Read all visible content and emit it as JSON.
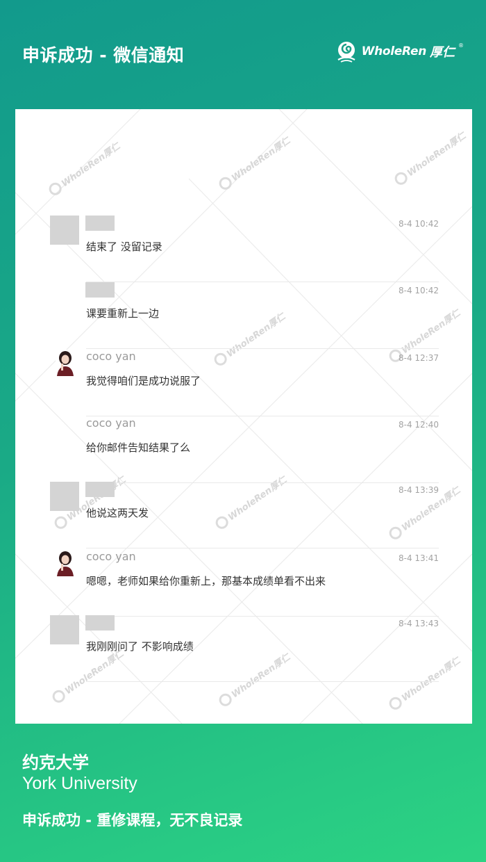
{
  "header": {
    "title": "申诉成功  - 微信通知"
  },
  "brand": {
    "logo_icon": "leaf-swirl-icon",
    "name": "WholeRen",
    "cn": "厚仁",
    "reg": "®"
  },
  "watermark": {
    "text": "WholeRen厚仁",
    "icon": "logo-icon"
  },
  "messages": [
    {
      "avatar": "gray-redacted",
      "name": "",
      "time": "8-4 10:42",
      "text": "结束了 没留记录"
    },
    {
      "avatar": "none",
      "name": "",
      "time": "8-4 10:42",
      "text": "课要重新上一边"
    },
    {
      "avatar": "photo",
      "name": "coco yan",
      "time": "8-4 12:37",
      "text": "我觉得咱们是成功说服了"
    },
    {
      "avatar": "none",
      "name": "coco yan",
      "time": "8-4 12:40",
      "text": "给你邮件告知结果了么"
    },
    {
      "avatar": "gray-redacted",
      "name": "",
      "time": "8-4 13:39",
      "text": "他说这两天发"
    },
    {
      "avatar": "photo",
      "name": "coco yan",
      "time": "8-4 13:41",
      "text": "嗯嗯，老师如果给你重新上，那基本成绩单看不出来"
    },
    {
      "avatar": "gray-redacted",
      "name": "",
      "time": "8-4 13:43",
      "text": "我刚刚问了 不影响成绩"
    }
  ],
  "footer": {
    "school_cn": "约克大学",
    "school_en": "York University",
    "result": "申诉成功 - 重修课程，无不良记录"
  },
  "colors": {
    "gradient_start": "#129a8c",
    "gradient_end": "#2cd383",
    "redaction_gray": "#d4d4d4",
    "text_dark": "#333333",
    "text_muted": "#a3a3a3"
  }
}
